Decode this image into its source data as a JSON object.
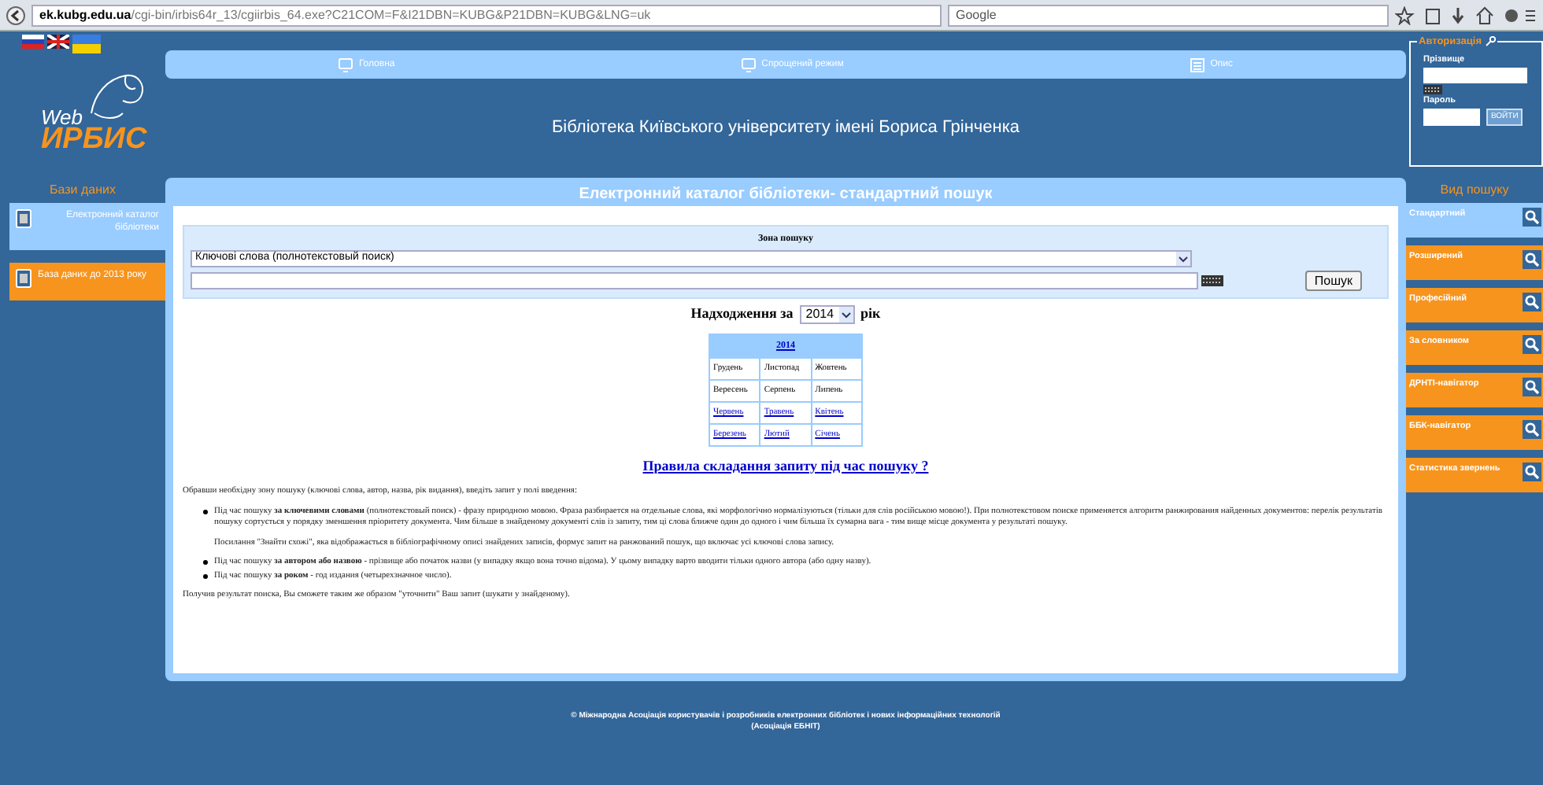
{
  "browser": {
    "url_host": "ek.kubg.edu.ua",
    "url_path": "/cgi-bin/irbis64r_13/cgiirbis_64.exe?C21COM=F&I21DBN=KUBG&P21DBN=KUBG&LNG=uk",
    "search_placeholder": "Google"
  },
  "logo": {
    "line1": "Web",
    "line2": "ИРБИС"
  },
  "nav": [
    {
      "label": "Головна",
      "kind": "screen"
    },
    {
      "label": "Спрощений режим",
      "kind": "screen"
    },
    {
      "label": "Опис",
      "kind": "doc"
    }
  ],
  "site_title": "Бібліотека Київського університету імені Бориса Грінченка",
  "databases": {
    "heading": "Бази даних",
    "items": [
      {
        "label": "Електронний каталог бібліотеки",
        "selected": true
      },
      {
        "label": "База даних до 2013 року",
        "selected": false
      }
    ]
  },
  "auth": {
    "heading": "Авторизація",
    "surname_label": "Прізвище",
    "password_label": "Пароль",
    "button": "ВОЙТИ"
  },
  "search_types": {
    "heading": "Вид пошуку",
    "items": [
      {
        "label": "Стандартний",
        "selected": true
      },
      {
        "label": "Розширений",
        "selected": false
      },
      {
        "label": "Професійний",
        "selected": false
      },
      {
        "label": "За словником",
        "selected": false
      },
      {
        "label": "ДРНТІ-навігатор",
        "selected": false
      },
      {
        "label": "ББК-навігатор",
        "selected": false
      },
      {
        "label": "Статистика звернень",
        "selected": false
      }
    ]
  },
  "panel_title": "Електронний каталог бібліотеки- стандартний пошук",
  "search": {
    "zone_label": "Зона пошуку",
    "zone_value": "Ключові слова (полнотекстовый поиск)",
    "button": "Пошук"
  },
  "arrivals": {
    "label_before": "Надходження за",
    "year": "2014",
    "label_after": "рік"
  },
  "calendar": {
    "year": "2014",
    "months": [
      {
        "label": "Грудень",
        "linked": false
      },
      {
        "label": "Листопад",
        "linked": false
      },
      {
        "label": "Жовтень",
        "linked": false
      },
      {
        "label": "Вересень",
        "linked": false
      },
      {
        "label": "Серпень",
        "linked": false
      },
      {
        "label": "Липень",
        "linked": false
      },
      {
        "label": "Червень",
        "linked": true
      },
      {
        "label": "Травень",
        "linked": true
      },
      {
        "label": "Квітень",
        "linked": true
      },
      {
        "label": "Березень",
        "linked": true
      },
      {
        "label": "Лютий",
        "linked": true
      },
      {
        "label": "Січень",
        "linked": true
      }
    ]
  },
  "rules_link": "Правила складання запиту під час пошуку ?",
  "help": {
    "intro": "Обравши необхідну зону пошуку (ключові слова, автор, назва, рік видання), введіть запит у полі введення:",
    "bullets": [
      {
        "text": "Під час пошуку **за ключевими словами** (полнотекстовый поиск) - фразу природною мовою. Фраза разбирается на отдельные слова, які морфологічно нормалізуються (тільки для слів російською мовою!). При полнотекстовом поиске применяется алгоритм ранжирования найденных документов: перелік результатів пошуку сортується у порядку зменшення пріоритету документа. Чим більше в знайденому документі слів із запиту, тим ці слова ближче один до одного і чим більша їх сумарна вага - тим вище місце документа у результаті пошуку.",
        "note": "Посилання \"Знайти схожі\", яка відображається в бібліографічному описі знайдених записів, формує запит на ранжований пошук, що включає усі ключові слова запису."
      },
      {
        "text": "Під час пошуку **за автором або назвою** - прізвище або початок назви (у випадку якщо вона точно відома). У цьому випадку варто вводити тільки одного автора (або одну назву)."
      },
      {
        "text": "Під час пошуку **за роком** - год издания (четырехзначное число)."
      }
    ],
    "outro": "Получив результат поиска, Вы сможете таким же образом \"уточнити\" Ваш запит (шукати у знайденому)."
  },
  "footer": {
    "line1": "© Міжнародна Асоціація користувачів і розробників електронних бібліотек і нових інформаційних технологій",
    "line2": "(Асоціація ЕБНІТ)"
  }
}
